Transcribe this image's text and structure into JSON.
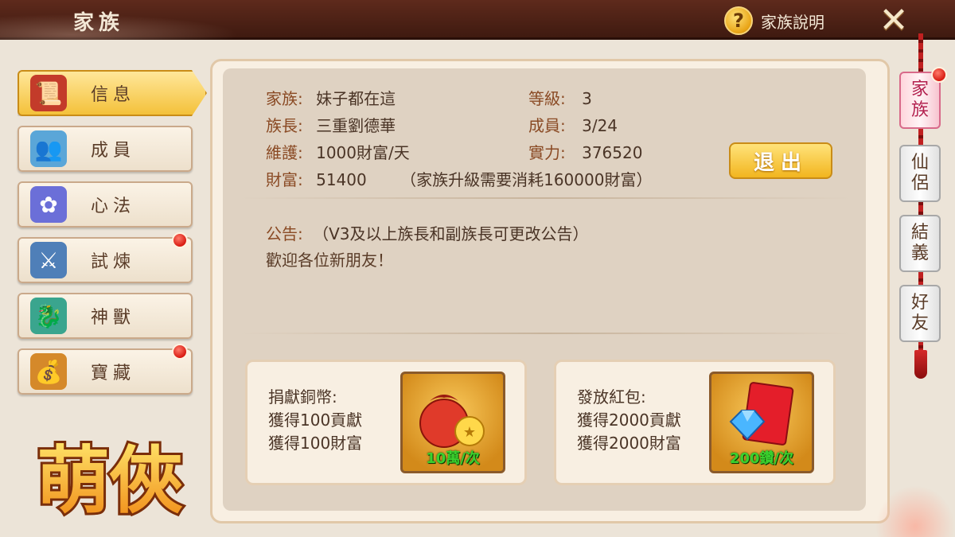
{
  "header": {
    "title": "家族",
    "help_icon_glyph": "?",
    "help_label": "家族說明",
    "close_glyph": "✕"
  },
  "left_tabs": [
    {
      "label": "信息",
      "icon": "scroll-icon",
      "active": true,
      "badge": false
    },
    {
      "label": "成員",
      "icon": "members-icon",
      "active": false,
      "badge": false
    },
    {
      "label": "心法",
      "icon": "lotus-icon",
      "active": false,
      "badge": false
    },
    {
      "label": "試煉",
      "icon": "sword-icon",
      "active": false,
      "badge": true
    },
    {
      "label": "神獸",
      "icon": "dragon-icon",
      "active": false,
      "badge": false
    },
    {
      "label": "寶藏",
      "icon": "treasure-chest-icon",
      "active": false,
      "badge": true
    }
  ],
  "logo_text": "萌俠",
  "info": {
    "family_label": "家族:",
    "family_value": "妹子都在這",
    "level_label": "等級:",
    "level_value": "3",
    "leader_label": "族長:",
    "leader_value": "三重劉德華",
    "members_label": "成員:",
    "members_value": "3/24",
    "upkeep_label": "維護:",
    "upkeep_value": "1000財富/天",
    "power_label": "實力:",
    "power_value": "376520",
    "wealth_label": "財富:",
    "wealth_value": "51400",
    "upgrade_note": "（家族升級需要消耗160000財富）",
    "exit_button": "退出"
  },
  "notice": {
    "label": "公告:",
    "hint": "（V3及以上族長和副族長可更改公告）",
    "text": "歡迎各位新朋友！"
  },
  "cards": [
    {
      "line1": "捐獻銅幣:",
      "line2": "獲得100貢獻",
      "line3": "獲得100財富",
      "price": "10萬/次",
      "icon": "coin-bag-icon"
    },
    {
      "line1": "發放紅包:",
      "line2": "獲得2000貢獻",
      "line3": "獲得2000財富",
      "price": "200鑽/次",
      "icon": "red-envelope-icon"
    }
  ],
  "right_tabs": [
    {
      "label": "家族",
      "active": true,
      "badge": true
    },
    {
      "label": "仙侶",
      "active": false,
      "badge": false
    },
    {
      "label": "結義",
      "active": false,
      "badge": false
    },
    {
      "label": "好友",
      "active": false,
      "badge": false
    }
  ],
  "colors": {
    "accent_gold": "#f4c13a",
    "header_brown": "#5e2a1c",
    "price_green": "#3bd12e",
    "badge_red": "#d81b12"
  }
}
